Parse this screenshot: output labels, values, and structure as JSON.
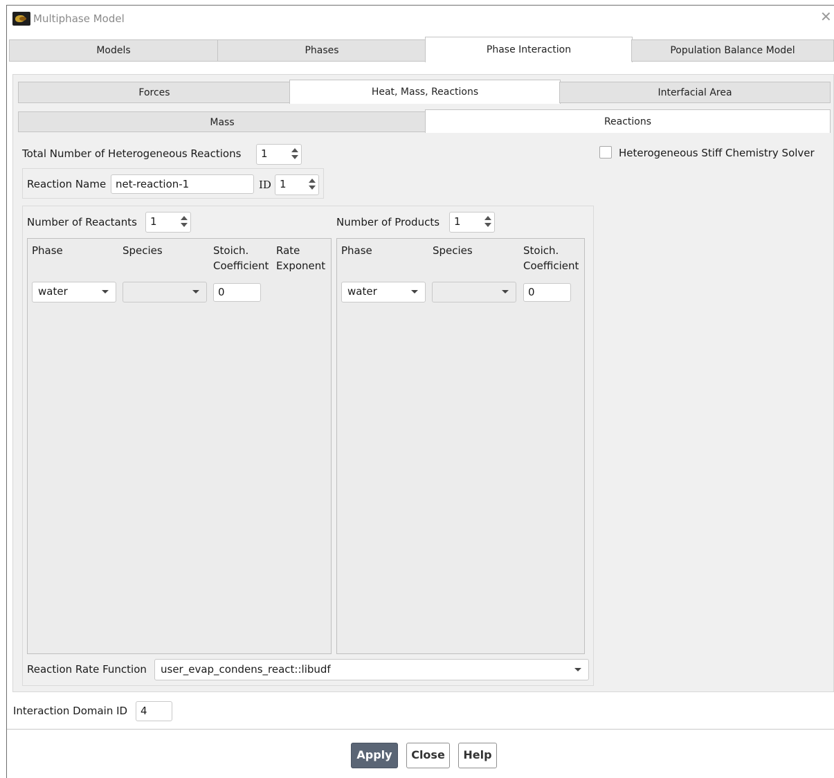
{
  "window": {
    "title": "Multiphase Model"
  },
  "main_tabs": [
    {
      "label": "Models",
      "active": false
    },
    {
      "label": "Phases",
      "active": false
    },
    {
      "label": "Phase Interaction",
      "active": true
    },
    {
      "label": "Population Balance Model",
      "active": false
    }
  ],
  "sub_tabs": [
    {
      "label": "Forces",
      "active": false
    },
    {
      "label": "Heat, Mass, Reactions",
      "active": true
    },
    {
      "label": "Interfacial Area",
      "active": false
    }
  ],
  "inner_tabs": [
    {
      "label": "Mass",
      "active": false
    },
    {
      "label": "Reactions",
      "active": true
    }
  ],
  "reactions": {
    "total_label": "Total Number of Heterogeneous Reactions",
    "total_value": "1",
    "stiff_solver_label": "Heterogeneous Stiff Chemistry Solver",
    "stiff_solver_checked": false,
    "reaction_name_label": "Reaction Name",
    "reaction_name_value": "net-reaction-1",
    "id_label": "ID",
    "id_value": "1"
  },
  "reactants": {
    "count_label": "Number of Reactants",
    "count_value": "1",
    "headers": {
      "phase": "Phase",
      "species": "Species",
      "stoich_1": "Stoich.",
      "stoich_2": "Coefficient",
      "rate_1": "Rate",
      "rate_2": "Exponent"
    },
    "rows": [
      {
        "phase": "water",
        "species": "",
        "stoich": "0"
      }
    ]
  },
  "products": {
    "count_label": "Number of Products",
    "count_value": "1",
    "headers": {
      "phase": "Phase",
      "species": "Species",
      "stoich_1": "Stoich.",
      "stoich_2": "Coefficient"
    },
    "rows": [
      {
        "phase": "water",
        "species": "",
        "stoich": "0"
      }
    ]
  },
  "rate_function": {
    "label": "Reaction Rate Function",
    "value": "user_evap_condens_react::libudf"
  },
  "interaction_domain": {
    "label": "Interaction Domain ID",
    "value": "4"
  },
  "buttons": {
    "apply": "Apply",
    "close": "Close",
    "help": "Help"
  },
  "icons": {
    "window": "fluent-app-icon",
    "close": "close-icon"
  }
}
